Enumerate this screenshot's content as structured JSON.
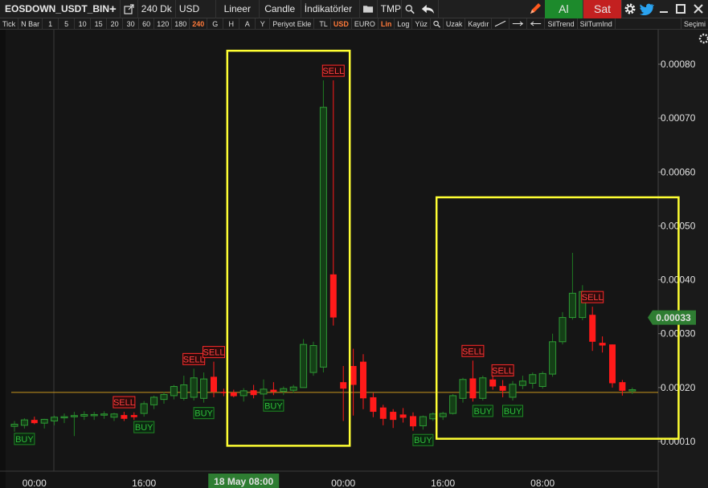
{
  "toolbar": {
    "symbol": "EOSDOWN_USDT_BIN",
    "add_icon": "plus-icon",
    "popout_icon": "external-link-icon",
    "period": "240 Dk",
    "currency": "USD",
    "scale": "Lineer",
    "chart_type": "Candle",
    "indicators": "İndikatörler",
    "folder_icon": "folder-icon",
    "template": "TMP",
    "zoom_icon": "zoom-icon",
    "back_icon": "undo-arrow-icon",
    "pencil_icon": "pencil-icon",
    "buy_label": "Al",
    "sell_label": "Sat",
    "gear_icon": "gear-icon",
    "twitter_icon": "twitter-icon",
    "minimize_icon": "minimize-icon",
    "maximize_icon": "maximize-icon",
    "close_icon": "close-icon"
  },
  "toolbar2": {
    "items": [
      "Tick",
      "N Bar",
      "1",
      "5",
      "10",
      "15",
      "20",
      "30",
      "60",
      "120",
      "180",
      "240",
      "G",
      "H",
      "A",
      "Y",
      "Periyot Ekle",
      "TL",
      "USD",
      "EURO",
      "Lin",
      "Log",
      "Yüz",
      "Uzak",
      "Kaydır",
      "SilTrend",
      "SilTumInd"
    ],
    "active": [
      "240",
      "USD",
      "Lin"
    ],
    "right_label": "Seçimi"
  },
  "chart_data": {
    "type": "candlestick",
    "y_ticks": [
      "0.00080",
      "0.00070",
      "0.00060",
      "0.00050",
      "0.00040",
      "0.00030",
      "0.00020",
      "0.00010"
    ],
    "y_tick_values": [
      0.0008,
      0.0007,
      0.0006,
      0.0005,
      0.0004,
      0.0003,
      0.0002,
      0.0001
    ],
    "ylim": [
      9e-05,
      0.00085
    ],
    "x_ticks": [
      "00:00",
      "16:00",
      "18 May 08:00",
      "00:00",
      "16:00",
      "08:00"
    ],
    "x_tick_index": [
      2,
      13,
      23,
      33,
      43,
      53
    ],
    "highlighted_x_tick": "18 May 08:00",
    "last_price": "0.00033",
    "last_price_value": 0.00033,
    "reference_line_value": 0.000191,
    "colors": {
      "up": "#1e7d22",
      "down": "#ff1a1a",
      "ref_line": "#c8961e",
      "highlight_box": "#ffff33",
      "last_price_bg": "#2e7d32"
    },
    "candles": [
      {
        "o": 0.000128,
        "h": 0.000138,
        "l": 0.000118,
        "c": 0.000132
      },
      {
        "o": 0.00013,
        "h": 0.000143,
        "l": 0.000124,
        "c": 0.00014
      },
      {
        "o": 0.00014,
        "h": 0.000146,
        "l": 0.000132,
        "c": 0.000134
      },
      {
        "o": 0.000134,
        "h": 0.000142,
        "l": 0.000124,
        "c": 0.000141
      },
      {
        "o": 0.000138,
        "h": 0.000148,
        "l": 0.00013,
        "c": 0.000145
      },
      {
        "o": 0.000145,
        "h": 0.000152,
        "l": 0.000134,
        "c": 0.000146
      },
      {
        "o": 0.000146,
        "h": 0.000155,
        "l": 0.00011,
        "c": 0.000148
      },
      {
        "o": 0.000147,
        "h": 0.000156,
        "l": 0.00014,
        "c": 0.00015
      },
      {
        "o": 0.000148,
        "h": 0.000155,
        "l": 0.00014,
        "c": 0.00015
      },
      {
        "o": 0.00015,
        "h": 0.000156,
        "l": 0.000142,
        "c": 0.000151
      },
      {
        "o": 0.000145,
        "h": 0.000153,
        "l": 0.000138,
        "c": 0.000151
      },
      {
        "o": 0.000149,
        "h": 0.000155,
        "l": 0.000138,
        "c": 0.000142
      },
      {
        "o": 0.000149,
        "h": 0.000154,
        "l": 0.00014,
        "c": 0.000145
      },
      {
        "o": 0.000152,
        "h": 0.000175,
        "l": 0.000146,
        "c": 0.00017
      },
      {
        "o": 0.000168,
        "h": 0.000185,
        "l": 0.00016,
        "c": 0.000182
      },
      {
        "o": 0.000178,
        "h": 0.000192,
        "l": 0.00017,
        "c": 0.000187
      },
      {
        "o": 0.000185,
        "h": 0.000205,
        "l": 0.000178,
        "c": 0.000202
      },
      {
        "o": 0.00018,
        "h": 0.000222,
        "l": 0.000176,
        "c": 0.000205
      },
      {
        "o": 0.000182,
        "h": 0.000235,
        "l": 0.000176,
        "c": 0.000218
      },
      {
        "o": 0.00018,
        "h": 0.000228,
        "l": 0.000172,
        "c": 0.000216
      },
      {
        "o": 0.00022,
        "h": 0.000248,
        "l": 0.000182,
        "c": 0.000192
      },
      {
        "o": 0.000192,
        "h": 0.000198,
        "l": 0.000184,
        "c": 0.00019
      },
      {
        "o": 0.000191,
        "h": 0.000196,
        "l": 0.000182,
        "c": 0.000184
      },
      {
        "o": 0.000185,
        "h": 0.000199,
        "l": 0.000174,
        "c": 0.000194
      },
      {
        "o": 0.000195,
        "h": 0.000205,
        "l": 0.00018,
        "c": 0.000186
      },
      {
        "o": 0.000188,
        "h": 0.000215,
        "l": 0.000178,
        "c": 0.000197
      },
      {
        "o": 0.000196,
        "h": 0.00021,
        "l": 0.000186,
        "c": 0.000192
      },
      {
        "o": 0.000193,
        "h": 0.000202,
        "l": 0.000186,
        "c": 0.000198
      },
      {
        "o": 0.000195,
        "h": 0.000205,
        "l": 0.00019,
        "c": 0.000201
      },
      {
        "o": 0.0002,
        "h": 0.00029,
        "l": 0.0002,
        "c": 0.00028
      },
      {
        "o": 0.000228,
        "h": 0.000285,
        "l": 0.000222,
        "c": 0.000278
      },
      {
        "o": 0.000238,
        "h": 0.00077,
        "l": 0.000228,
        "c": 0.00072
      },
      {
        "o": 0.00041,
        "h": 0.00077,
        "l": 0.000315,
        "c": 0.00033
      },
      {
        "o": 0.00021,
        "h": 0.00024,
        "l": 0.000138,
        "c": 0.000198
      },
      {
        "o": 0.00024,
        "h": 0.000272,
        "l": 0.000148,
        "c": 0.000205
      },
      {
        "o": 0.000248,
        "h": 0.000262,
        "l": 0.00016,
        "c": 0.00018
      },
      {
        "o": 0.000182,
        "h": 0.00019,
        "l": 0.000145,
        "c": 0.000155
      },
      {
        "o": 0.000163,
        "h": 0.000168,
        "l": 0.00013,
        "c": 0.000142
      },
      {
        "o": 0.000155,
        "h": 0.00016,
        "l": 0.000125,
        "c": 0.00014
      },
      {
        "o": 0.00015,
        "h": 0.000162,
        "l": 0.000135,
        "c": 0.000144
      },
      {
        "o": 0.000147,
        "h": 0.000154,
        "l": 0.00012,
        "c": 0.000128
      },
      {
        "o": 0.000129,
        "h": 0.000148,
        "l": 0.000122,
        "c": 0.000146
      },
      {
        "o": 0.000142,
        "h": 0.000154,
        "l": 0.000138,
        "c": 0.000151
      },
      {
        "o": 0.000146,
        "h": 0.000155,
        "l": 0.00014,
        "c": 0.000152
      },
      {
        "o": 0.000152,
        "h": 0.000188,
        "l": 0.00015,
        "c": 0.000185
      },
      {
        "o": 0.00018,
        "h": 0.000218,
        "l": 0.000172,
        "c": 0.000215
      },
      {
        "o": 0.000217,
        "h": 0.00025,
        "l": 0.000174,
        "c": 0.00018
      },
      {
        "o": 0.00018,
        "h": 0.000222,
        "l": 0.000176,
        "c": 0.000218
      },
      {
        "o": 0.000215,
        "h": 0.000242,
        "l": 0.000196,
        "c": 0.000202
      },
      {
        "o": 0.000203,
        "h": 0.000214,
        "l": 0.000182,
        "c": 0.000194
      },
      {
        "o": 0.000182,
        "h": 0.000212,
        "l": 0.000176,
        "c": 0.000206
      },
      {
        "o": 0.000204,
        "h": 0.000222,
        "l": 0.000197,
        "c": 0.000212
      },
      {
        "o": 0.000208,
        "h": 0.000228,
        "l": 0.000198,
        "c": 0.000224
      },
      {
        "o": 0.000202,
        "h": 0.00023,
        "l": 0.000198,
        "c": 0.000226
      },
      {
        "o": 0.000225,
        "h": 0.0003,
        "l": 0.00022,
        "c": 0.000285
      },
      {
        "o": 0.000285,
        "h": 0.00034,
        "l": 0.00028,
        "c": 0.00033
      },
      {
        "o": 0.00033,
        "h": 0.00045,
        "l": 0.000326,
        "c": 0.000375
      },
      {
        "o": 0.00033,
        "h": 0.00039,
        "l": 0.000325,
        "c": 0.000378
      },
      {
        "o": 0.000335,
        "h": 0.00035,
        "l": 0.000268,
        "c": 0.000285
      },
      {
        "o": 0.000283,
        "h": 0.000295,
        "l": 0.000265,
        "c": 0.000278
      },
      {
        "o": 0.00028,
        "h": 0.00028,
        "l": 0.0002,
        "c": 0.000208
      },
      {
        "o": 0.00021,
        "h": 0.000214,
        "l": 0.000185,
        "c": 0.000194
      },
      {
        "o": 0.000195,
        "h": 0.0002,
        "l": 0.000188,
        "c": 0.000196
      }
    ],
    "signals": [
      {
        "label": "BUY",
        "index": 1,
        "pos": "below",
        "kind": "buy"
      },
      {
        "label": "BUY",
        "index": 13,
        "pos": "below",
        "kind": "buy"
      },
      {
        "label": "SELL",
        "index": 11,
        "pos": "above",
        "kind": "sell"
      },
      {
        "label": "SELL",
        "index": 18,
        "pos": "above",
        "kind": "sell"
      },
      {
        "label": "SELL",
        "index": 20,
        "pos": "above",
        "kind": "sell"
      },
      {
        "label": "BUY",
        "index": 19,
        "pos": "below",
        "kind": "buy"
      },
      {
        "label": "BUY",
        "index": 26,
        "pos": "below",
        "kind": "buy"
      },
      {
        "label": "SELL",
        "index": 32,
        "pos": "above",
        "kind": "sell"
      },
      {
        "label": "BUY",
        "index": 41,
        "pos": "below",
        "kind": "buy"
      },
      {
        "label": "SELL",
        "index": 46,
        "pos": "above",
        "kind": "sell"
      },
      {
        "label": "BUY",
        "index": 47,
        "pos": "below",
        "kind": "buy"
      },
      {
        "label": "SELL",
        "index": 49,
        "pos": "above",
        "kind": "sell"
      },
      {
        "label": "BUY",
        "index": 50,
        "pos": "below",
        "kind": "buy"
      },
      {
        "label": "SELL",
        "index": 58,
        "pos": "above",
        "kind": "sell"
      }
    ],
    "highlight_boxes": [
      {
        "from_index": 22,
        "to_index": 33,
        "y_top": 0.000825,
        "y_bottom": 9.2e-05
      },
      {
        "from_index": 43,
        "to_index": 66,
        "y_top": 0.000553,
        "y_bottom": 0.000105
      }
    ]
  }
}
